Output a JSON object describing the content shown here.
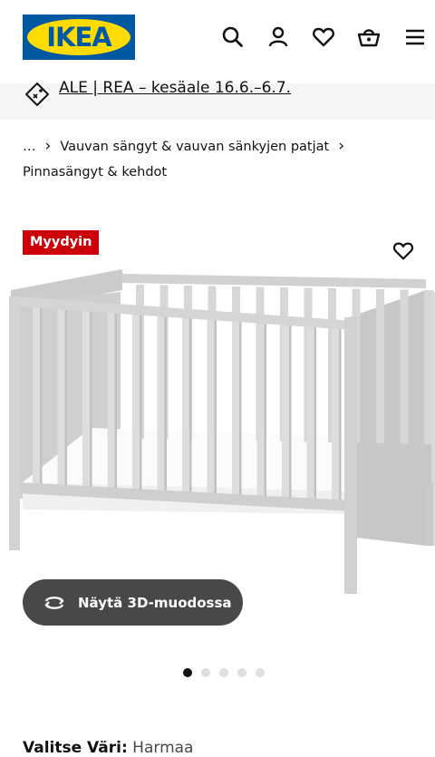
{
  "header": {
    "logo_text": "IKEA",
    "icons": [
      "search-icon",
      "user-icon",
      "heart-icon",
      "basket-icon",
      "menu-icon"
    ],
    "brand_blue": "#0058a3",
    "brand_yellow": "#ffdb00"
  },
  "banner": {
    "icon": "price-tag-icon",
    "text": "ALE | REA – kesäale 16.6.–6.7."
  },
  "breadcrumb": {
    "ellipsis": "…",
    "item1": "Vauvan sängyt & vauvan sänkyjen patjat",
    "item2": "Pinnasängyt & kehdot",
    "separator": "›"
  },
  "product": {
    "badge": "Myydyin",
    "badge_color": "#cc0008",
    "view3d_label": "Näytä 3D-muodossa",
    "image_count": 5,
    "active_image": 1
  },
  "variant": {
    "label": "Valitse Väri:",
    "value": "Harmaa"
  }
}
